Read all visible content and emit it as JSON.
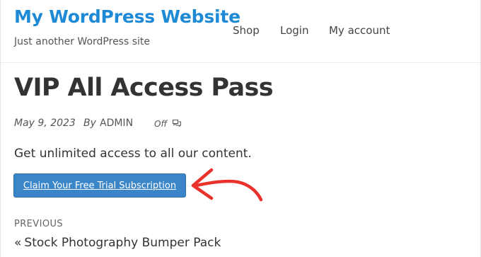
{
  "site": {
    "title": "My WordPress Website",
    "tagline": "Just another WordPress site"
  },
  "nav": {
    "items": [
      {
        "label": "Shop"
      },
      {
        "label": "Login"
      },
      {
        "label": "My account"
      }
    ]
  },
  "post": {
    "title": "VIP All Access Pass",
    "date": "May 9, 2023",
    "by_label": "By",
    "author": "ADMIN",
    "comments_status": "Off",
    "comments_icon": "comment-icon",
    "body": "Get unlimited access to all our content.",
    "cta_label": "Claim Your Free Trial Subscription"
  },
  "post_nav": {
    "previous_label": "PREVIOUS",
    "previous_chevron": "«",
    "previous_title": "Stock Photography Bumper Pack"
  },
  "colors": {
    "site_title": "#1e8ad6",
    "button_bg": "#3a86c8",
    "annotation_arrow": "#e8322b"
  }
}
